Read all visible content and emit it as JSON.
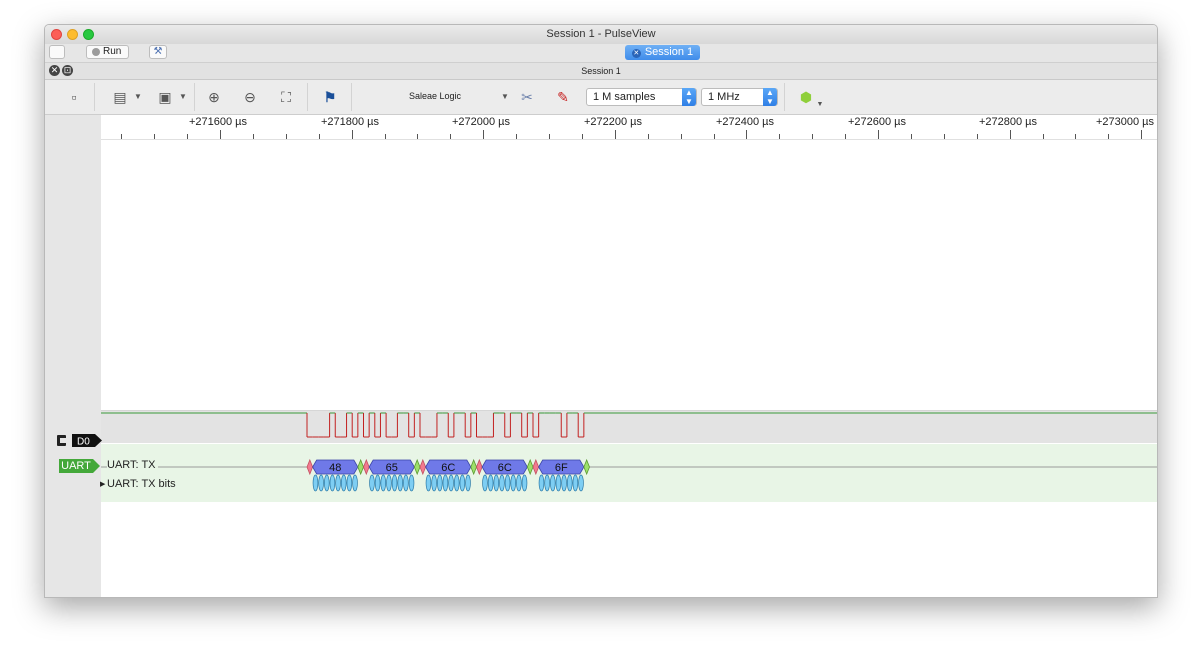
{
  "window": {
    "title": "Session 1 - PulseView"
  },
  "main_toolbar": {
    "run_label": "Run",
    "session_tab": "Session 1"
  },
  "session_bar": {
    "title": "Session 1"
  },
  "toolbar": {
    "device": "Saleae Logic",
    "samples": "1 M samples",
    "samplerate": "1 MHz"
  },
  "ruler": {
    "labels": [
      "+271600 µs",
      "+271800 µs",
      "+272000 µs",
      "+272200 µs",
      "+272400 µs",
      "+272600 µs",
      "+272800 µs",
      "+273000 µs"
    ]
  },
  "channels": {
    "logic_name": "D0",
    "decoder_name": "UART",
    "rows": [
      "UART: TX",
      "UART: TX bits"
    ]
  },
  "decoded": {
    "bytes": [
      "48",
      "65",
      "6C",
      "6C",
      "6F"
    ]
  },
  "colors": {
    "signal_high": "#3a9a3a",
    "signal_low": "#c22020",
    "byte_fill": "#6f79e8",
    "bit_fill": "#7ecef3",
    "start_fill": "#f27a8f",
    "stop_fill": "#9de06a",
    "decoder_badge": "#44a83a"
  }
}
